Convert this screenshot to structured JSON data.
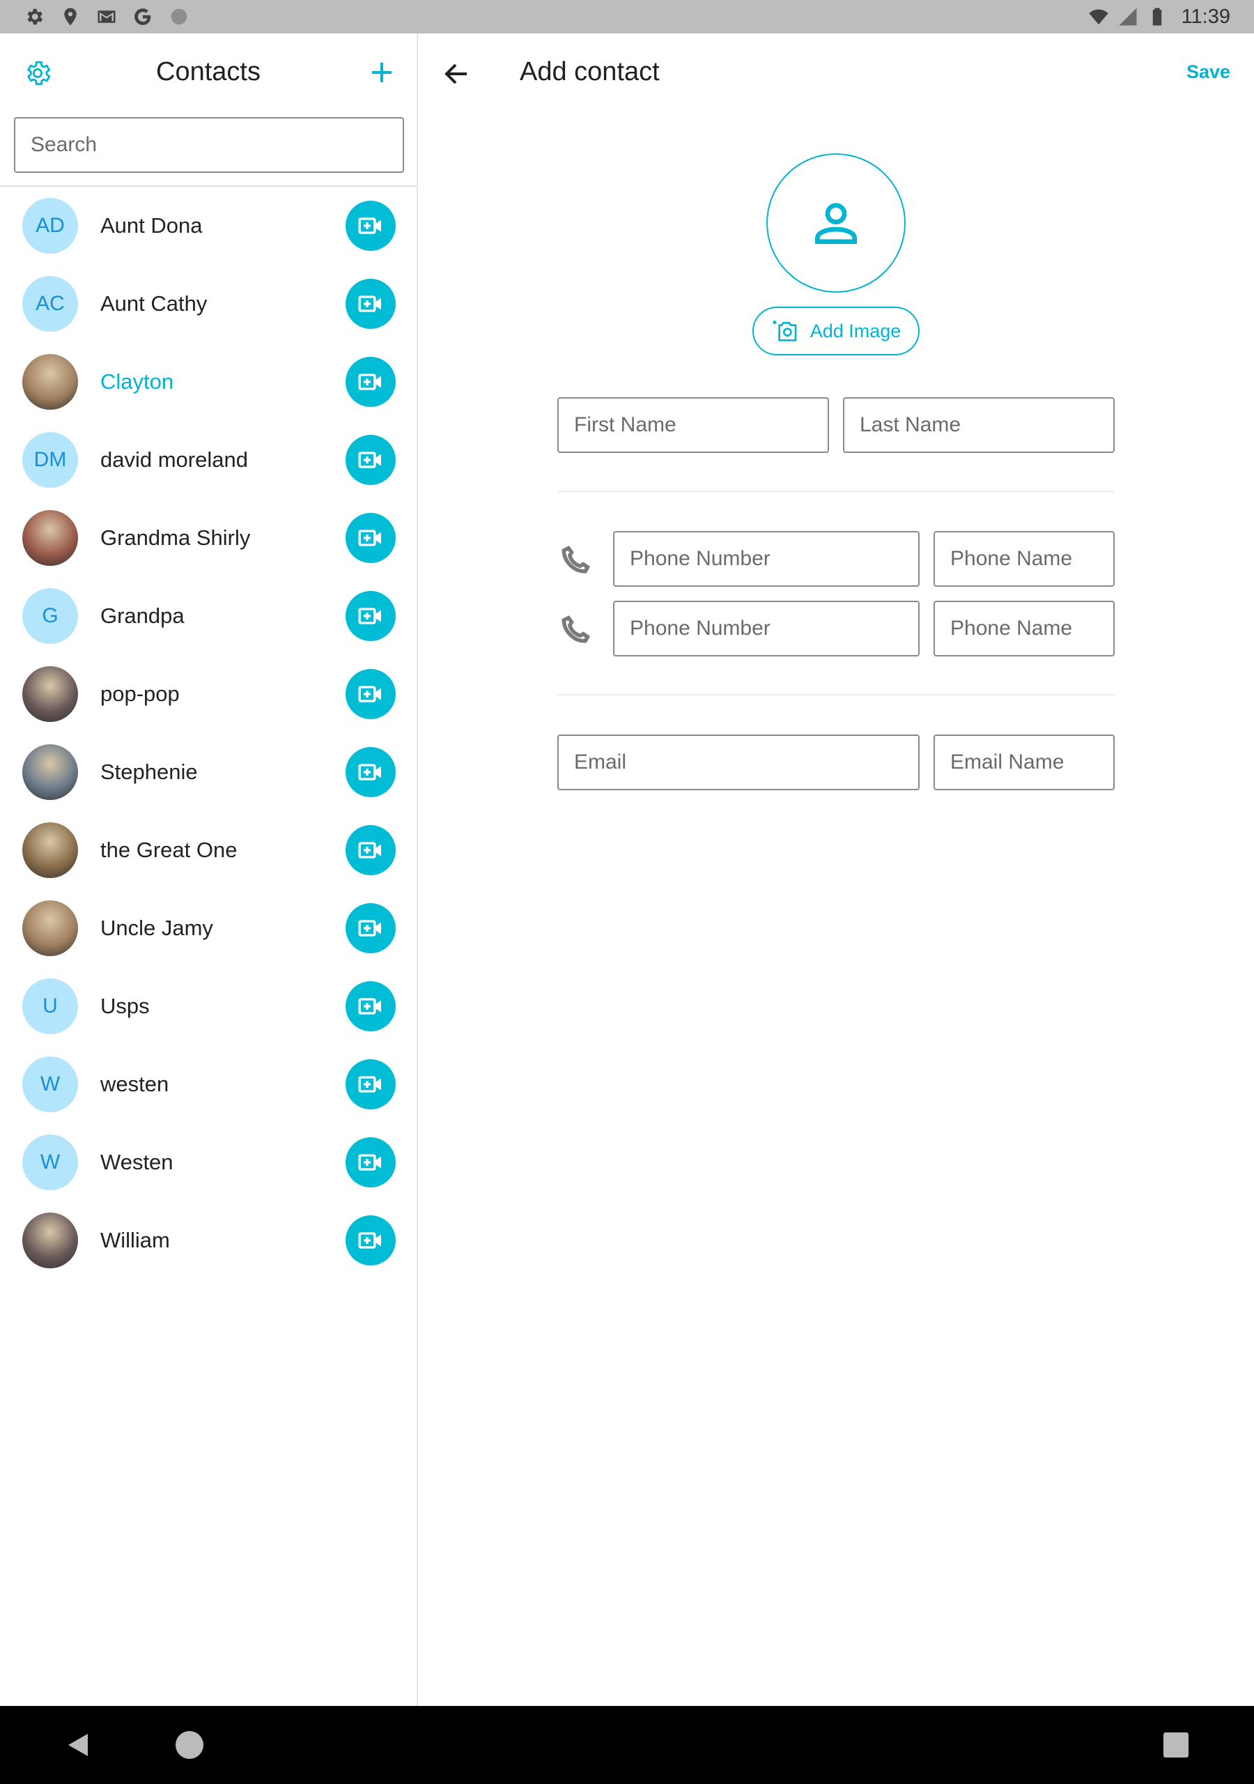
{
  "status_bar": {
    "time": "11:39",
    "left_icons": [
      "settings-icon",
      "location-icon",
      "gmail-icon",
      "google-icon",
      "circle-icon"
    ],
    "right_icons": [
      "wifi-icon",
      "signal-icon",
      "battery-icon"
    ]
  },
  "contacts_pane": {
    "title": "Contacts",
    "search_placeholder": "Search",
    "icons": {
      "settings": "gear-icon",
      "add": "plus-icon",
      "call": "video-call-icon"
    },
    "contacts": [
      {
        "name": "Aunt Dona",
        "initials": "AD",
        "photo": false,
        "active": false
      },
      {
        "name": "Aunt Cathy",
        "initials": "AC",
        "photo": false,
        "active": false
      },
      {
        "name": "Clayton",
        "initials": "",
        "photo": true,
        "active": true
      },
      {
        "name": "david moreland",
        "initials": "DM",
        "photo": false,
        "active": false
      },
      {
        "name": "Grandma Shirly",
        "initials": "",
        "photo": true,
        "active": false
      },
      {
        "name": "Grandpa",
        "initials": "G",
        "photo": false,
        "active": false
      },
      {
        "name": "pop-pop",
        "initials": "",
        "photo": true,
        "active": false
      },
      {
        "name": "Stephenie",
        "initials": "",
        "photo": true,
        "active": false
      },
      {
        "name": "the Great One",
        "initials": "",
        "photo": true,
        "active": false
      },
      {
        "name": "Uncle Jamy",
        "initials": "",
        "photo": true,
        "active": false
      },
      {
        "name": "Usps",
        "initials": "U",
        "photo": false,
        "active": false
      },
      {
        "name": "westen",
        "initials": "W",
        "photo": false,
        "active": false
      },
      {
        "name": "Westen",
        "initials": "W",
        "photo": false,
        "active": false
      },
      {
        "name": "William",
        "initials": "",
        "photo": true,
        "active": false
      }
    ]
  },
  "add_contact": {
    "title": "Add contact",
    "save_label": "Save",
    "add_image_label": "Add Image",
    "first_name_placeholder": "First Name",
    "last_name_placeholder": "Last Name",
    "phones": [
      {
        "number_placeholder": "Phone Number",
        "name_placeholder": "Phone Name"
      },
      {
        "number_placeholder": "Phone Number",
        "name_placeholder": "Phone Name"
      }
    ],
    "email_placeholder": "Email",
    "email_name_placeholder": "Email Name"
  },
  "colors": {
    "accent": "#00b4d2",
    "initials_bg": "#b3e5fc",
    "initials_text": "#1a8fd6",
    "status_bar": "#bdbdbd",
    "nav_bar": "#000000"
  }
}
